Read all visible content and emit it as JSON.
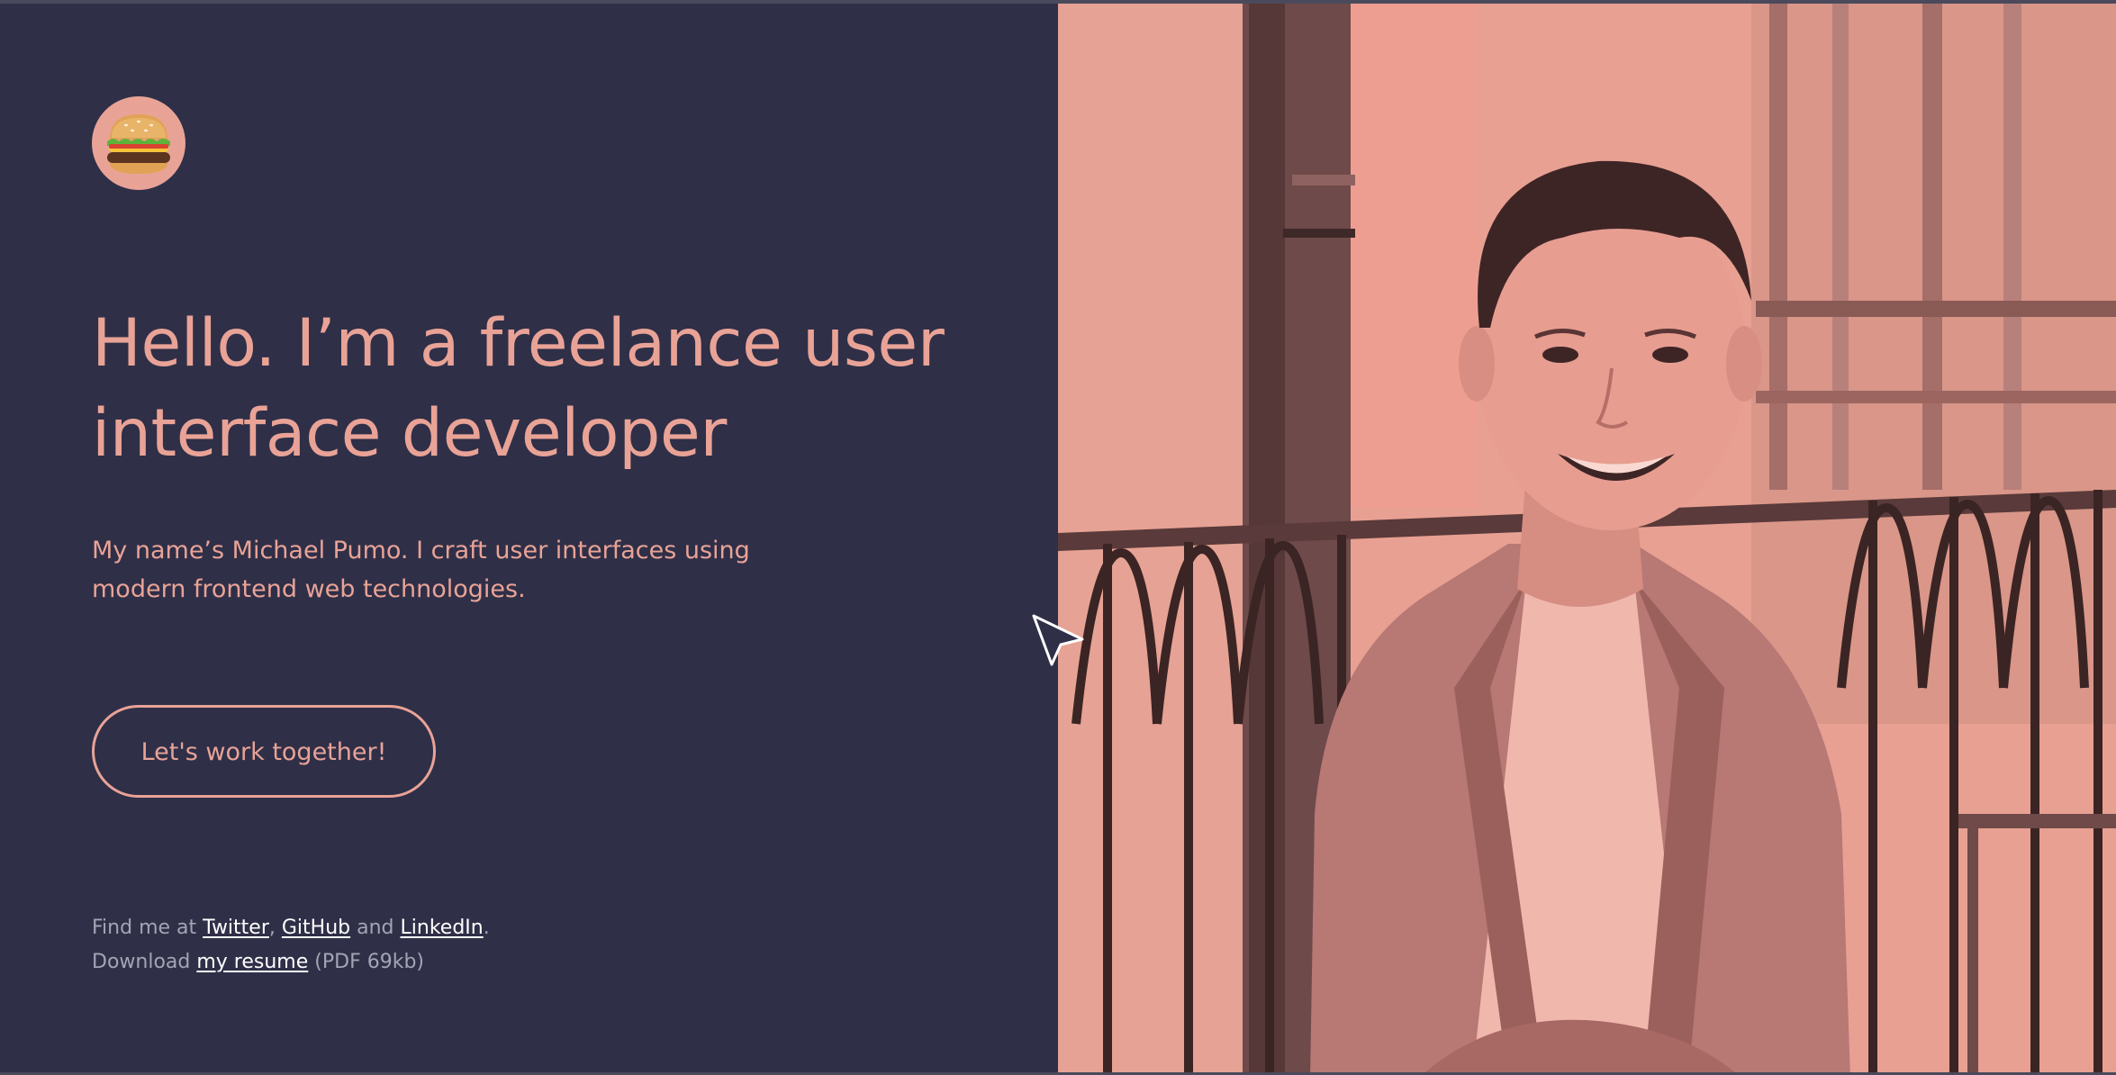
{
  "logo": {
    "icon": "burger-icon",
    "bg": "#e9a396"
  },
  "hero": {
    "headline": "Hello. I’m a freelance user interface developer",
    "intro": "My name’s Michael Pumo. I craft user interfaces using modern frontend web technologies.",
    "cta": "Let's work together!"
  },
  "footer": {
    "find_prefix": "Find me at ",
    "twitter": "Twitter",
    "comma": ", ",
    "github": "GitHub",
    "and": " and ",
    "linkedin": "LinkedIn",
    "period": ".",
    "download_prefix": "Download ",
    "resume": "my resume",
    "resume_meta": " (PDF 69kb)"
  },
  "colors": {
    "background": "#2f2f48",
    "accent": "#e9a396",
    "link": "#ffffff",
    "muted_text": "#a4a4b5"
  }
}
